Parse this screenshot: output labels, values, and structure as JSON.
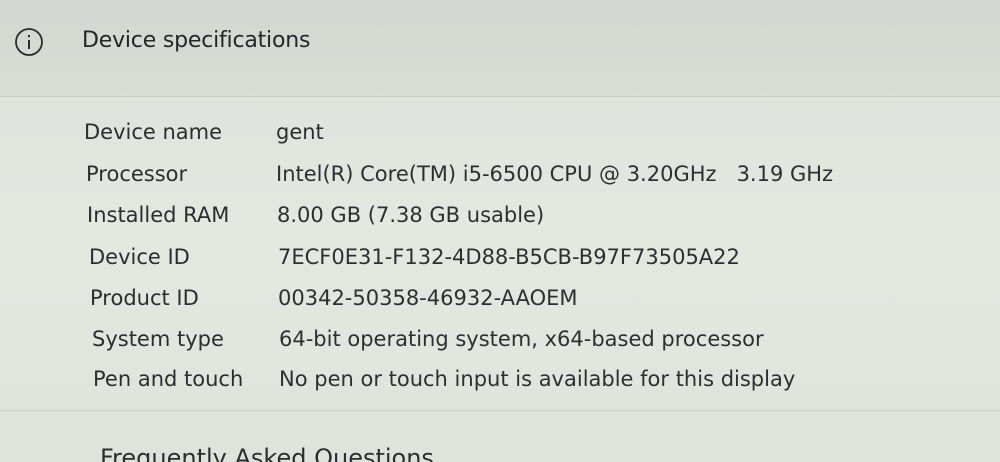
{
  "header": {
    "icon": "info-icon",
    "title": "Device specifications"
  },
  "specs": [
    {
      "label": "Device name",
      "value": "gent"
    },
    {
      "label": "Processor",
      "value": "Intel(R) Core(TM) i5-6500 CPU @ 3.20GHz   3.19 GHz"
    },
    {
      "label": "Installed RAM",
      "value": "8.00 GB (7.38 GB usable)"
    },
    {
      "label": "Device ID",
      "value": "7ECF0E31-F132-4D88-B5CB-B97F73505A22"
    },
    {
      "label": "Product ID",
      "value": "00342-50358-46932-AAOEM"
    },
    {
      "label": "System type",
      "value": "64-bit operating system, x64-based processor"
    },
    {
      "label": "Pen and touch",
      "value": "No pen or touch input is available for this display"
    }
  ],
  "next_section": {
    "title": "Frequently Asked Questions"
  }
}
